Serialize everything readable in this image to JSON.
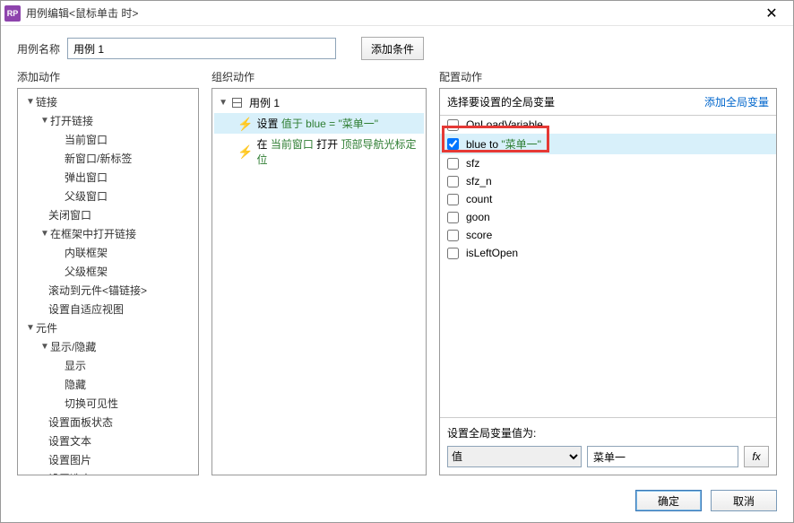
{
  "window": {
    "title": "用例编辑<鼠标单击 时>"
  },
  "top": {
    "name_label": "用例名称",
    "name_value": "用例 1",
    "add_condition": "添加条件"
  },
  "cols": {
    "add_action": "添加动作",
    "org_action": "组织动作",
    "cfg_action": "配置动作"
  },
  "tree": {
    "link": "链接",
    "open_link": "打开链接",
    "cur_win": "当前窗口",
    "new_win": "新窗口/新标签",
    "popup": "弹出窗口",
    "parent_win": "父级窗口",
    "close_win": "关闭窗口",
    "open_in_frame": "在框架中打开链接",
    "inline_frame": "内联框架",
    "parent_frame": "父级框架",
    "scroll_to": "滚动到元件<锚链接>",
    "adaptive": "设置自适应视图",
    "component": "元件",
    "show_hide": "显示/隐藏",
    "show": "显示",
    "hide": "隐藏",
    "toggle_vis": "切换可见性",
    "panel_state": "设置面板状态",
    "set_text": "设置文本",
    "set_image": "设置图片",
    "set_selected": "设置选中"
  },
  "org": {
    "case_label": "用例 1",
    "row1_a": "设置 ",
    "row1_b": "值于 blue = \"菜单一\"",
    "row2_a": "在 ",
    "row2_b": "当前窗口",
    "row2_c": " 打开 ",
    "row2_d": "顶部导航光标定位"
  },
  "cfg": {
    "select_label": "选择要设置的全局变量",
    "add_global": "添加全局变量",
    "vars": [
      {
        "name": "OnLoadVariable",
        "checked": false
      },
      {
        "name_a": "blue to ",
        "name_b": "\"菜单一\"",
        "checked": true,
        "sel": true,
        "highlight": true
      },
      {
        "name": "sfz",
        "checked": false
      },
      {
        "name": "sfz_n",
        "checked": false
      },
      {
        "name": "count",
        "checked": false
      },
      {
        "name": "goon",
        "checked": false
      },
      {
        "name": "score",
        "checked": false
      },
      {
        "name": "isLeftOpen",
        "checked": false
      }
    ],
    "bottom_label": "设置全局变量值为:",
    "type_value": "值",
    "input_value": "菜单一",
    "fx": "fx"
  },
  "dlg": {
    "ok": "确定",
    "cancel": "取消"
  }
}
